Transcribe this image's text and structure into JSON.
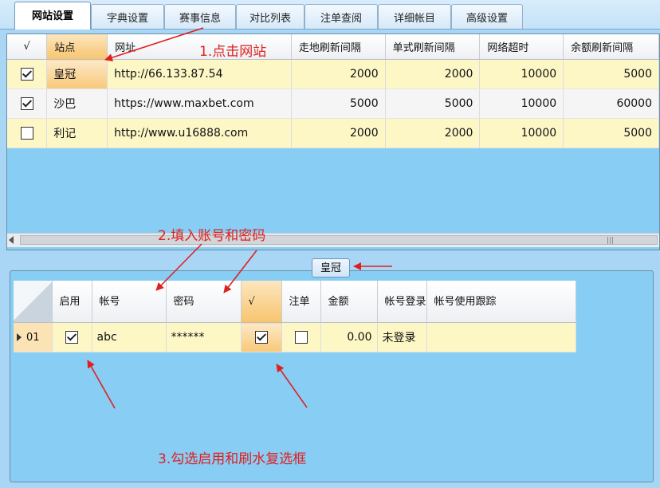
{
  "tabs": [
    {
      "label": "网站设置",
      "active": true
    },
    {
      "label": "字典设置"
    },
    {
      "label": "赛事信息"
    },
    {
      "label": "对比列表"
    },
    {
      "label": "注单查阅"
    },
    {
      "label": "详细帐目"
    },
    {
      "label": "高级设置"
    }
  ],
  "site_grid": {
    "headers": [
      "√",
      "站点",
      "网址",
      "走地刷新间隔",
      "单式刷新间隔",
      "网络超时",
      "余额刷新间隔"
    ],
    "rows": [
      {
        "checked": true,
        "site": "皇冠",
        "url": "http://66.133.87.54",
        "live_interval": "2000",
        "single_interval": "2000",
        "timeout": "10000",
        "balance_interval": "5000"
      },
      {
        "checked": true,
        "site": "沙巴",
        "url": "https://www.maxbet.com",
        "live_interval": "5000",
        "single_interval": "5000",
        "timeout": "10000",
        "balance_interval": "60000"
      },
      {
        "checked": false,
        "site": "利记",
        "url": "http://www.u16888.com",
        "live_interval": "2000",
        "single_interval": "2000",
        "timeout": "10000",
        "balance_interval": "5000"
      }
    ]
  },
  "account_group": {
    "title": "皇冠",
    "headers": [
      "启用",
      "帐号",
      "密码",
      "√",
      "注单",
      "金额",
      "帐号登录",
      "帐号使用跟踪"
    ],
    "rows": [
      {
        "index": "01",
        "enabled": true,
        "account": "abc",
        "password": "******",
        "brush": true,
        "bet": false,
        "amount": "0.00",
        "login_status": "未登录",
        "tracking": ""
      }
    ]
  },
  "annotations": {
    "step1": "1.点击网站",
    "step2": "2.填入账号和密码",
    "step3": "3.勾选启用和刷水复选框",
    "color": "#e02020"
  },
  "colors": {
    "grid_bg": "#87cdf4",
    "row_highlight": "#fdf7c6",
    "selected_cell": "#f8c878"
  }
}
